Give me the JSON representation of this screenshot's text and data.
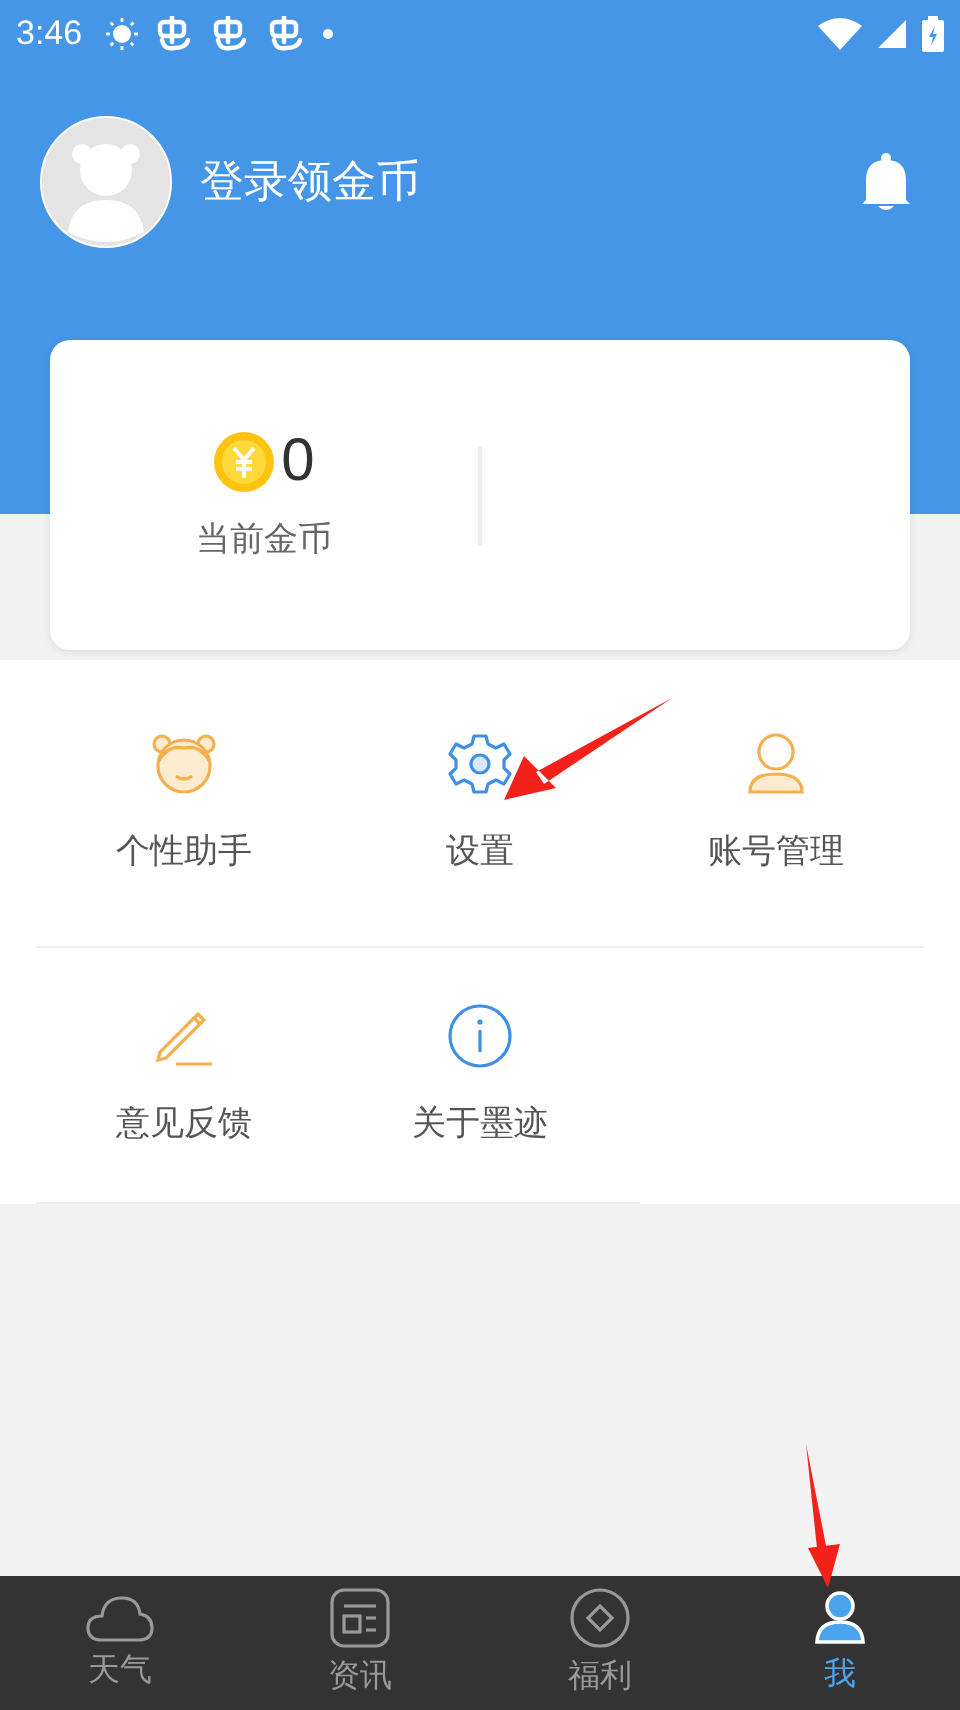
{
  "status_bar": {
    "time": "3:46"
  },
  "header": {
    "login_text": "登录领金币"
  },
  "coin_card": {
    "amount": "0",
    "label": "当前金币"
  },
  "menu": [
    {
      "kind": "assistant",
      "label": "个性助手"
    },
    {
      "kind": "settings",
      "label": "设置"
    },
    {
      "kind": "account",
      "label": "账号管理"
    },
    {
      "kind": "feedback",
      "label": "意见反馈"
    },
    {
      "kind": "about",
      "label": "关于墨迹"
    }
  ],
  "tabs": [
    {
      "kind": "weather",
      "label": "天气",
      "selected": false
    },
    {
      "kind": "news",
      "label": "资讯",
      "selected": false
    },
    {
      "kind": "welfare",
      "label": "福利",
      "selected": false
    },
    {
      "kind": "me",
      "label": "我",
      "selected": true
    }
  ]
}
